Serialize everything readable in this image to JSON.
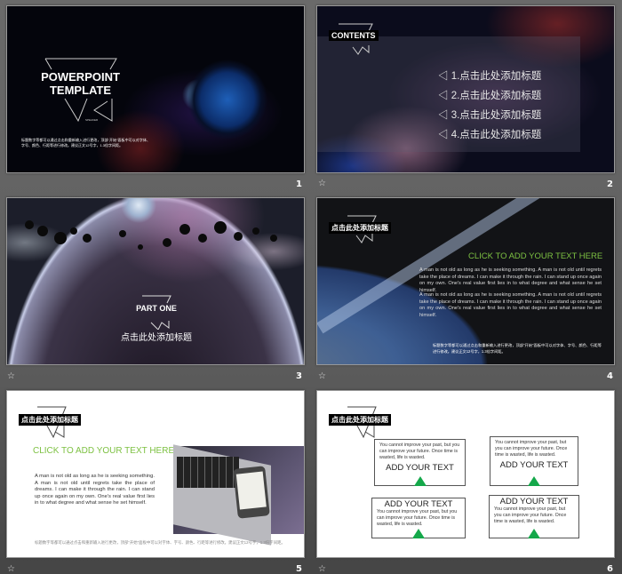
{
  "slides": [
    {
      "number": "1",
      "title_line1": "POWERPOINT",
      "title_line2": "TEMPLATE",
      "speaker": "SPEAKER",
      "body": "标题数字等都可以通过点击和重新输入进行更改，顶部“开始”面板中可以对字体、字号、颜色、行距等进行修改。建议正文12号字，1.3倍字间距。"
    },
    {
      "number": "2",
      "heading": "CONTENTS",
      "items": [
        "1.点击此处添加标题",
        "2.点击此处添加标题",
        "3.点击此处添加标题",
        "4.点击此处添加标题"
      ]
    },
    {
      "number": "3",
      "part": "PART ONE",
      "subtitle": "点击此处添加标题"
    },
    {
      "number": "4",
      "heading": "点击此处添加标题",
      "green": "CLICK TO ADD YOUR TEXT  HERE",
      "paragraphs": [
        "A man  is not old as long as he is seeking  something.  A man is not old until regrets take  the  place of dreams.  I can make  it through  the rain. I can stand up once again on my own.  One's real value  first lies in to what degree and what sense he set himself.",
        "A man  is not old as long as he is seeking  something.  A man is not old until regrets take  the  place of dreams.  I can make  it through  the rain. I can stand up once again on my own.  One's real value  first lies in to what degree and what sense he set himself."
      ],
      "footer": "标题数字等都可以通过点击和重新输入进行更改，顶部“开始”面板中可以对字体、字号、颜色、行距等进行修改。建议正文12号字，1.3倍字间距。"
    },
    {
      "number": "5",
      "heading": "点击此处添加标题",
      "green": "CLICK TO ADD YOUR TEXT  HERE",
      "paragraph": "A man  is not old as long as he is seeking something.  A man is not old until regrets take the place of dreams.  I can make  it through  the rain.  I can stand up once again on my own.  One's real value  first lies in to what degree and what sense he set himself.",
      "footer": "标题数字等都可以通过点击和重新输入进行更改，顶部“开始”面板中可以对字体、字号、颜色、行距等进行修改。建议正文12号字，1.3倍字间距。"
    },
    {
      "number": "6",
      "heading": "点击此处添加标题",
      "boxes": [
        {
          "title": "ADD YOUR TEXT",
          "text": "You cannot  improve  your past, but you can improve  your future.  Once time is wasted,  life is wasted."
        },
        {
          "title": "ADD YOUR TEXT",
          "text": "You cannot  improve  your past, but you can improve  your future. Once time is wasted,  life is wasted."
        },
        {
          "title": "ADD YOUR TEXT",
          "text": "You cannot  improve  your past, but you can improve  your future. Once time is wasted, life is wasted."
        },
        {
          "title": "ADD YOUR TEXT",
          "text": "You cannot  improve  your past, but you can improve  your future. Once time is wasted,  life is wasted."
        }
      ]
    }
  ],
  "colors": {
    "accent_green": "#7dc142",
    "triangle_green": "#14a84a"
  },
  "icons": {
    "slide_transition": "star-icon"
  }
}
